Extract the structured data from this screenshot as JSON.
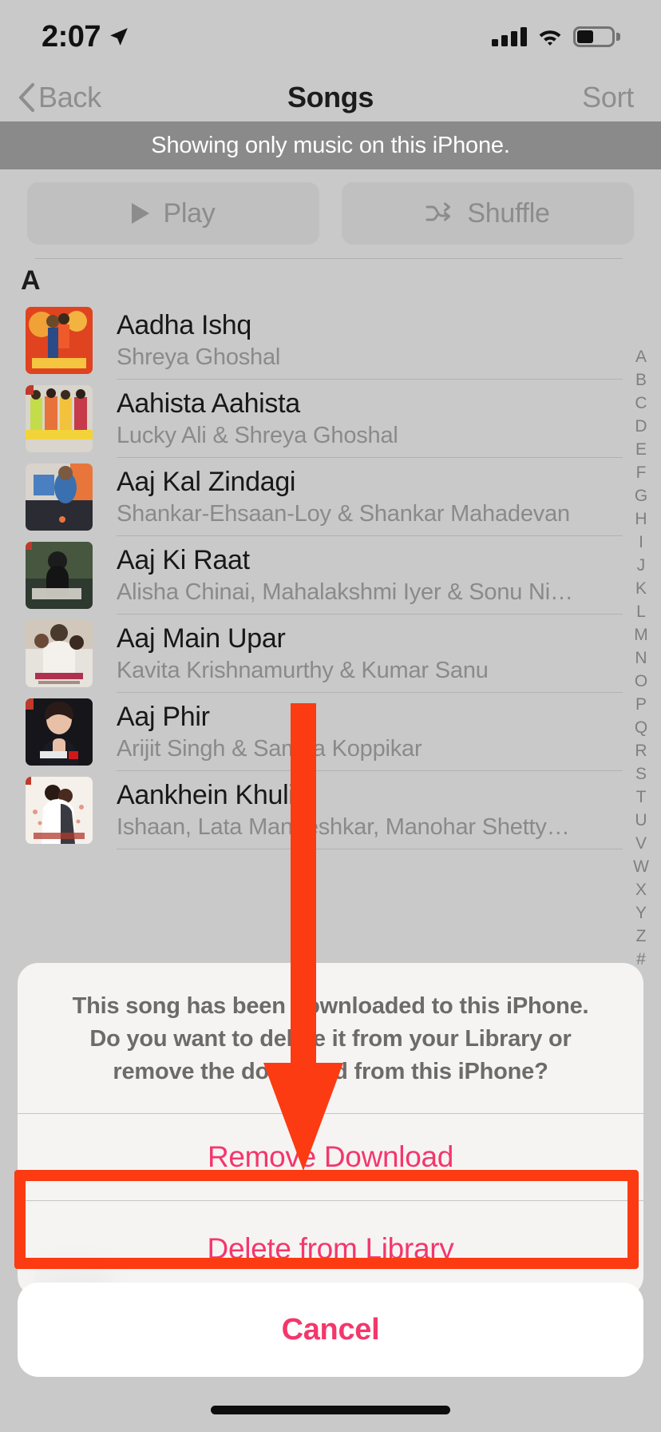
{
  "status_bar": {
    "time": "2:07",
    "location_icon": "location-arrow-icon",
    "signal_icon": "cellular-bars-icon",
    "wifi_icon": "wifi-icon",
    "battery_icon": "battery-icon"
  },
  "nav": {
    "back_label": "Back",
    "title": "Songs",
    "sort_label": "Sort"
  },
  "banner": {
    "text": "Showing only music on this iPhone."
  },
  "actions": {
    "play_label": "Play",
    "shuffle_label": "Shuffle"
  },
  "list": {
    "section_header": "A",
    "rows": [
      {
        "title": "Aadha Ishq",
        "artist": "Shreya Ghoshal",
        "art": "bol-bachchan-art"
      },
      {
        "title": "Aahista Aahista",
        "artist": "Lucky Ali & Shreya Ghoshal",
        "art": "bachna-e-haseeno-art"
      },
      {
        "title": "Aaj Kal Zindagi",
        "artist": "Shankar-Ehsaan-Loy & Shankar Mahadevan",
        "art": "wake-up-sid-art"
      },
      {
        "title": "Aaj Ki Raat",
        "artist": "Alisha Chinai, Mahalakshmi Iyer & Sonu Ni…",
        "art": "don-art"
      },
      {
        "title": "Aaj Main Upar",
        "artist": "Kavita Krishnamurthy & Kumar Sanu",
        "art": "khamoshi-art"
      },
      {
        "title": "Aaj Phir",
        "artist": "Arijit Singh & Samira Koppikar",
        "art": "hate-story-2-art"
      },
      {
        "title": "Aankhein Khuli",
        "artist": "Ishaan, Lata Mangeshkar, Manohar Shetty…",
        "art": "mohabbatein-art"
      }
    ]
  },
  "alpha_index": [
    "A",
    "B",
    "C",
    "D",
    "E",
    "F",
    "G",
    "H",
    "I",
    "J",
    "K",
    "L",
    "M",
    "N",
    "O",
    "P",
    "Q",
    "R",
    "S",
    "T",
    "U",
    "V",
    "W",
    "X",
    "Y",
    "Z",
    "#"
  ],
  "sheet": {
    "message": "This song has been downloaded to this iPhone. Do you want to delete it from your Library or remove the download from this iPhone?",
    "remove_download_label": "Remove Download",
    "delete_library_label": "Delete from Library",
    "cancel_label": "Cancel"
  },
  "annotation": {
    "arrow_color": "#fc3b12",
    "highlight_color": "#fc3b12",
    "target": "Delete from Library"
  },
  "colors": {
    "background": "#c9c9c9",
    "banner": "#8a8a8a",
    "destructive": "#f4376b",
    "annotation": "#fc3b12"
  }
}
